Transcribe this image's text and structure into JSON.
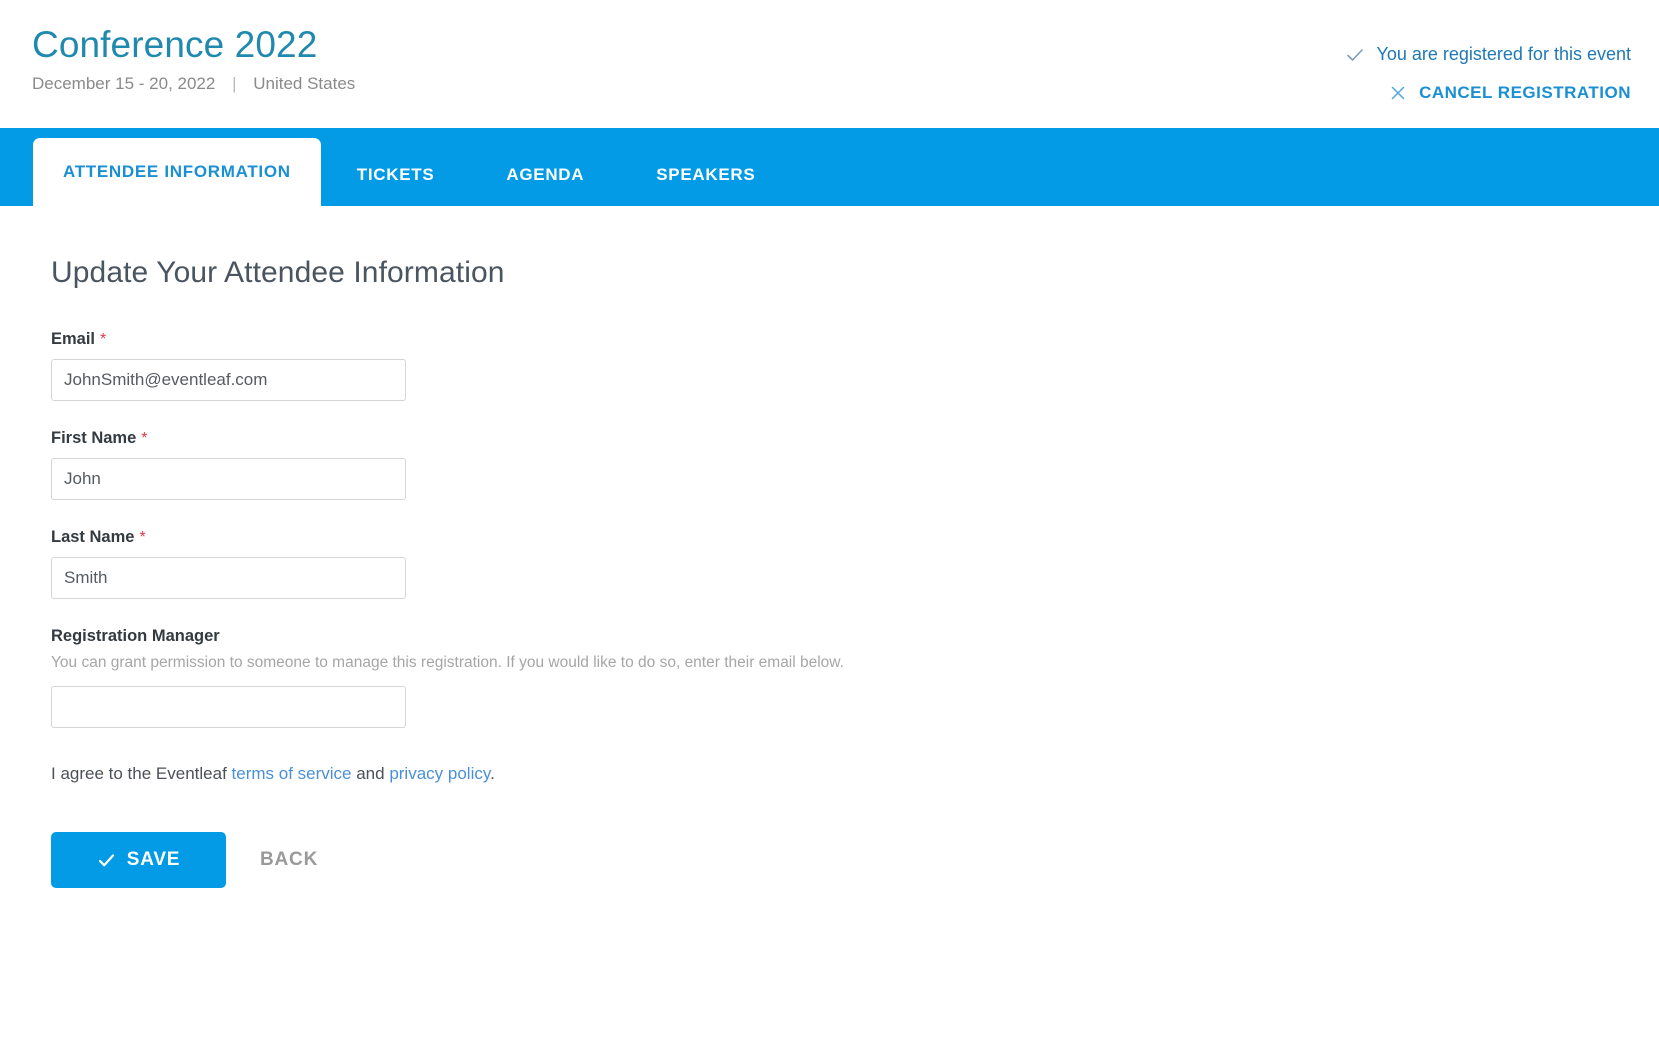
{
  "header": {
    "event_title": "Conference 2022",
    "event_dates": "December 15 - 20, 2022",
    "separator": "|",
    "event_location": "United States",
    "registration_status": "You are registered for this event",
    "cancel_registration_label": "CANCEL REGISTRATION",
    "check_icon": "check-icon",
    "close_icon": "close-icon"
  },
  "tabs": [
    {
      "label": "ATTENDEE INFORMATION",
      "active": true
    },
    {
      "label": "TICKETS",
      "active": false
    },
    {
      "label": "AGENDA",
      "active": false
    },
    {
      "label": "SPEAKERS",
      "active": false
    }
  ],
  "main": {
    "heading": "Update Your Attendee Information",
    "fields": {
      "email": {
        "label": "Email",
        "required_marker": "*",
        "value": "JohnSmith@eventleaf.com",
        "placeholder": ""
      },
      "first_name": {
        "label": "First Name",
        "required_marker": "*",
        "value": "John",
        "placeholder": ""
      },
      "last_name": {
        "label": "Last Name",
        "required_marker": "*",
        "value": "Smith",
        "placeholder": ""
      },
      "registration_manager": {
        "label": "Registration Manager",
        "help_text": "You can grant permission to someone to manage this registration. If you would like to do so, enter their email below.",
        "value": "",
        "placeholder": ""
      }
    },
    "agreement": {
      "prefix": "I agree to the Eventleaf ",
      "terms_link": "terms of service",
      "middle": " and ",
      "privacy_link": "privacy policy",
      "suffix": "."
    },
    "actions": {
      "save_label": "SAVE",
      "save_icon": "check-icon",
      "back_label": "BACK"
    }
  },
  "colors": {
    "brand_blue": "#039BE5",
    "title_teal": "#2089AE",
    "link_blue": "#4a90d9",
    "required_red": "#e2394a",
    "muted_gray": "#a6a6a6"
  }
}
